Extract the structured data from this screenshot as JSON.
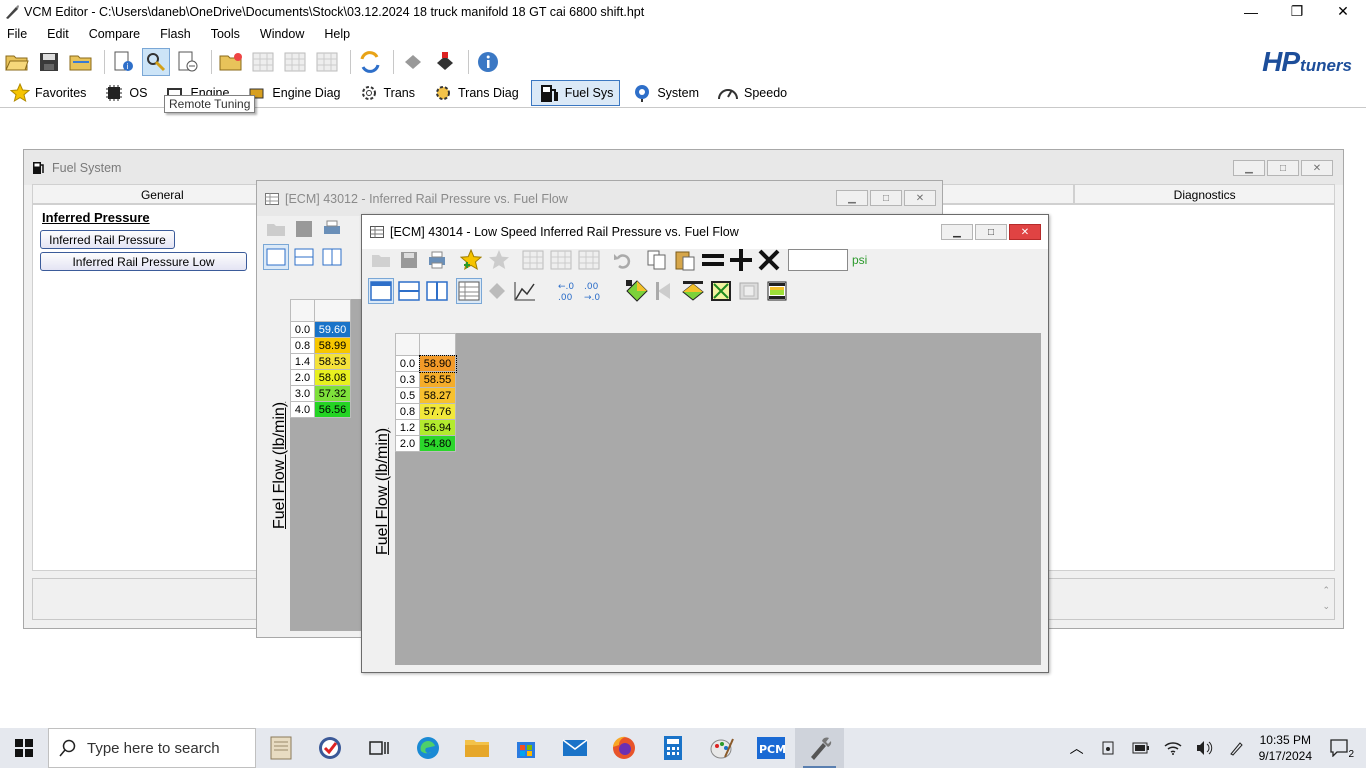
{
  "window": {
    "title": "VCM Editor - C:\\Users\\daneb\\OneDrive\\Documents\\Stock\\03.12.2024 18 truck manifold 18 GT cai 6800 shift.hpt",
    "minimize": "—",
    "maximize": "❐",
    "close": "✕"
  },
  "menu": [
    "File",
    "Edit",
    "Compare",
    "Flash",
    "Tools",
    "Window",
    "Help"
  ],
  "logo": {
    "hp": "HP",
    "tuners": "tuners"
  },
  "nav": [
    "Favorites",
    "OS",
    "Engine",
    "Engine Diag",
    "Trans",
    "Trans Diag",
    "Fuel Sys",
    "System",
    "Speedo"
  ],
  "tooltip": "Remote Tuning",
  "fuel_system": {
    "title": "Fuel System",
    "tabs": [
      "General",
      "",
      "",
      "",
      "Diagnostics"
    ],
    "heading": "Inferred Pressure",
    "buttons": [
      "Inferred Rail Pressure",
      "Inferred Rail Pressure Low"
    ]
  },
  "table1": {
    "title": "[ECM] 43012 - Inferred Rail Pressure vs. Fuel Flow",
    "axis_label": "Fuel Flow (lb/min)",
    "rows": [
      {
        "axis": "0.0",
        "value": "59.60",
        "color": "#1a73c8",
        "text": "#fff"
      },
      {
        "axis": "0.8",
        "value": "58.99",
        "color": "#f7c600",
        "text": "#000"
      },
      {
        "axis": "1.4",
        "value": "58.53",
        "color": "#f4e23a",
        "text": "#000"
      },
      {
        "axis": "2.0",
        "value": "58.08",
        "color": "#e8f020",
        "text": "#000"
      },
      {
        "axis": "3.0",
        "value": "57.32",
        "color": "#7ee03b",
        "text": "#000"
      },
      {
        "axis": "4.0",
        "value": "56.56",
        "color": "#24d424",
        "text": "#000"
      }
    ]
  },
  "table2": {
    "title": "[ECM] 43014 - Low Speed Inferred Rail Pressure vs. Fuel Flow",
    "unit": "psi",
    "value_input": "",
    "axis_label": "Fuel Flow (lb/min)",
    "rows": [
      {
        "axis": "0.0",
        "value": "58.90",
        "color": "#f29a28",
        "text": "#000"
      },
      {
        "axis": "0.3",
        "value": "58.55",
        "color": "#f5ad2a",
        "text": "#000"
      },
      {
        "axis": "0.5",
        "value": "58.27",
        "color": "#f7c12e",
        "text": "#000"
      },
      {
        "axis": "0.8",
        "value": "57.76",
        "color": "#f2e83a",
        "text": "#000"
      },
      {
        "axis": "1.2",
        "value": "56.94",
        "color": "#b2ea2e",
        "text": "#000"
      },
      {
        "axis": "2.0",
        "value": "54.80",
        "color": "#2bd62b",
        "text": "#000"
      }
    ]
  },
  "taskbar": {
    "search_placeholder": "Type here to search",
    "time": "10:35 PM",
    "date": "9/17/2024",
    "notifications": "2"
  }
}
